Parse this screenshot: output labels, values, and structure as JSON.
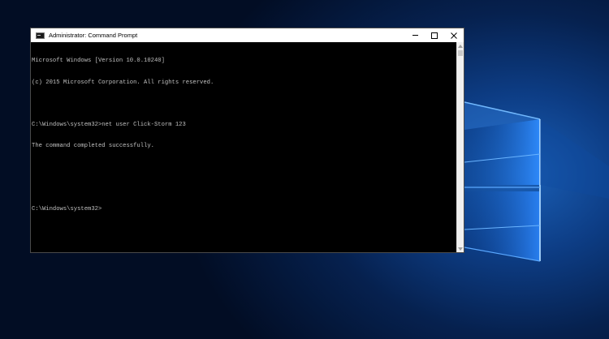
{
  "window": {
    "title": "Administrator: Command Prompt",
    "controls": {
      "minimize": "minimize",
      "maximize": "maximize",
      "close": "close"
    }
  },
  "console": {
    "lines": [
      "Microsoft Windows [Version 10.0.10240]",
      "(c) 2015 Microsoft Corporation. All rights reserved.",
      "",
      "C:\\Windows\\system32>net user Click-Storm 123",
      "The command completed successfully.",
      "",
      "",
      "C:\\Windows\\system32>"
    ]
  },
  "colors": {
    "console_bg": "#000000",
    "console_text": "#c0c0c0",
    "titlebar_bg": "#ffffff",
    "desktop_accent": "#1a6fd8"
  },
  "icons": {
    "app": "command-prompt-icon",
    "minimize": "minimize-icon",
    "maximize": "maximize-icon",
    "close": "close-icon"
  }
}
